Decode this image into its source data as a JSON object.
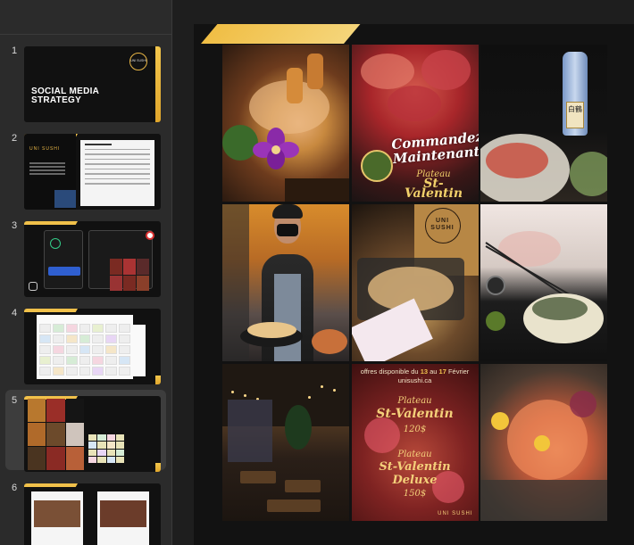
{
  "sidebar": {
    "slides": [
      {
        "number": "1",
        "title": "SOCIAL MEDIA STRATEGY",
        "logo_text": "UNI SUSHI",
        "selected": false
      },
      {
        "number": "2",
        "logo_text": "UNI SUSHI",
        "selected": false
      },
      {
        "number": "3",
        "selected": false
      },
      {
        "number": "4",
        "selected": false
      },
      {
        "number": "5",
        "selected": true
      },
      {
        "number": "6",
        "selected": false
      }
    ]
  },
  "slide": {
    "promo": {
      "headline": "Commandez Maintenant!",
      "sub_small": "Plateau",
      "sub_big": "St-Valentin"
    },
    "bottle_label": "白鶴",
    "bag_logo": "UNI SUSHI",
    "menu": {
      "offer_prefix": "offres disponible du ",
      "offer_day1": "13",
      "offer_mid": " au ",
      "offer_day2": "17",
      "offer_suffix": " Février",
      "website": "unisushi.ca",
      "item1_small": "Plateau",
      "item1_big": "St-Valentin",
      "item1_price": "120$",
      "item2_small": "Plateau",
      "item2_big": "St-Valentin Deluxe",
      "item2_price": "150$",
      "brand_mark": "UNI SUSHI"
    }
  },
  "colors": {
    "accent_gold": "#f0be45",
    "background": "#1e1e1e",
    "sidebar": "#2b2b2b",
    "selected_slide": "#3d3d3d"
  }
}
